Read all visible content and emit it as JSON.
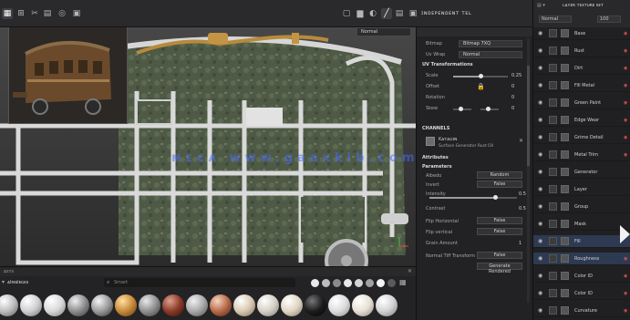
{
  "toolbar": {
    "title": "ɪɴᴅᴇᴘᴇɴᴅᴇɴᴛ ᴛᴇʟ",
    "icons": [
      "layers-icon",
      "grid-icon",
      "scissors-icon",
      "ruler-icon",
      "target-icon",
      "camera-icon",
      "gear-icon",
      "window-icon",
      "render-icon",
      "paint-icon",
      "brush-icon"
    ]
  },
  "viewport": {
    "dropdown_label": "Normal",
    "watermark": "ᴍᴇᴄᴀ www.gaaxkib.com"
  },
  "shelf": {
    "title": "ᴀsᴛs",
    "tab_label": "ᴀlᴍalᴇɢᴇs",
    "search_placeholder": "Smart",
    "colors": {
      "accent": "#3d6fd6",
      "background": "#232325"
    }
  },
  "properties": {
    "fields": [
      {
        "label": "Bitmap",
        "value": "Bitmap 7XQ"
      },
      {
        "label": "Uv Wrap",
        "value": "Normal"
      }
    ],
    "section_uv": "UV Transformations",
    "uv_rows": [
      {
        "label": "Scale",
        "value": "0.25"
      },
      {
        "label": "Offset",
        "value": "0"
      },
      {
        "label": "Rotation",
        "value": "0"
      },
      {
        "label": "Skew",
        "value": "0"
      }
    ],
    "section_channels": "CHANNELS",
    "material_name": "Kᴀᴛᴀɢɪɴ",
    "material_desc": "Surface Generator Rust Oil",
    "section_attributes": "Attributes",
    "section_parameters": "Parameters",
    "param_rows": [
      {
        "label": "Albedo",
        "value": "Random"
      },
      {
        "label": "Invert",
        "value": "False"
      },
      {
        "label": "Intensity",
        "value": "0.5"
      },
      {
        "label": "Contrast",
        "value": "0.5"
      },
      {
        "label": "Flip Horizontal",
        "value": "False"
      },
      {
        "label": "Flip vertical",
        "value": "False"
      },
      {
        "label": "Grain Amount",
        "value": "1"
      },
      {
        "label": "Normal Tiff Transform",
        "value": "False"
      }
    ],
    "bottom_button": "Generate Rendered",
    "progress": {
      "scale": 0.5,
      "intensity": 0.75
    }
  },
  "layers": {
    "header": "ʟᴀʏᴇʀ ᴛᴇxᴛᴜʀᴇ sᴇᴛ",
    "blend_mode": "Normal",
    "opacity": "100",
    "items": [
      {
        "name": "Base",
        "badge": "◉"
      },
      {
        "name": "Rust",
        "badge": "◉"
      },
      {
        "name": "Dirt",
        "badge": "◉"
      },
      {
        "name": "Fill Metal",
        "badge": "◉"
      },
      {
        "name": "Green Paint",
        "badge": "◉"
      },
      {
        "name": "Edge Wear",
        "badge": "◉"
      },
      {
        "name": "Grime Detail",
        "badge": "◉"
      },
      {
        "name": "Metal Trim",
        "badge": "◉"
      },
      {
        "name": "Generator",
        "badge": ""
      },
      {
        "name": "Layer",
        "badge": ""
      },
      {
        "name": "Group",
        "badge": ""
      },
      {
        "name": "Mask",
        "badge": ""
      },
      {
        "name": "Fill",
        "badge": ""
      },
      {
        "name": "Roughness",
        "badge": "◉"
      },
      {
        "name": "Color ID",
        "badge": "◉"
      },
      {
        "name": "Color ID",
        "badge": "◉"
      },
      {
        "name": "Curvature",
        "badge": "◉"
      }
    ]
  }
}
